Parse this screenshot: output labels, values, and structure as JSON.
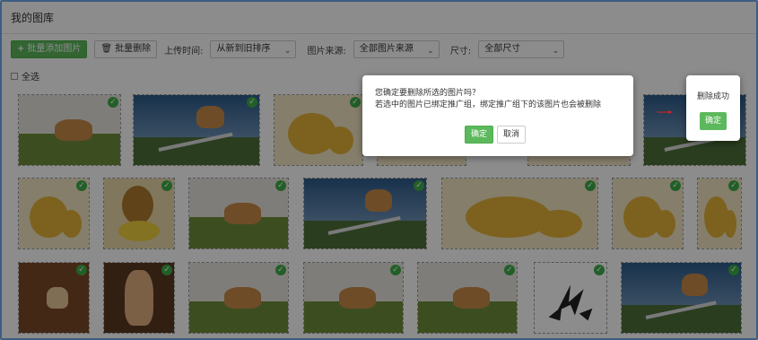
{
  "header": {
    "title": "我的图库"
  },
  "toolbar": {
    "batch_add_label": "批量添加图片",
    "batch_delete_label": "批量删除",
    "upload_time_label": "上传时间:",
    "upload_time_value": "从新到旧排序",
    "source_label": "图片来源:",
    "source_value": "全部图片来源",
    "size_label": "尺寸:",
    "size_value": "全部尺寸"
  },
  "select_all": {
    "label": "全选"
  },
  "dialog": {
    "line1": "您确定要删除所选的图片吗？",
    "line2": "若选中的图片已绑定推广组，绑定推广组下的该图片也会被删除",
    "confirm_label": "确定",
    "cancel_label": "取消"
  },
  "toast": {
    "message": "删除成功",
    "ok_label": "确定"
  },
  "colors": {
    "accent_green": "#5cb85c",
    "check_green": "#3fae49",
    "arrow_red": "#e02020",
    "frame_blue": "#3c5c82"
  },
  "tiles": [
    {
      "kind": "dog-grass",
      "checked": true
    },
    {
      "kind": "dog-jump",
      "checked": true
    },
    {
      "kind": "bear",
      "checked": true
    },
    {
      "kind": "bear",
      "checked": false
    },
    {
      "kind": "bear",
      "checked": false
    },
    {
      "kind": "dog-jump",
      "checked": false
    },
    {
      "kind": "bear",
      "checked": true
    },
    {
      "kind": "bear-family",
      "checked": true
    },
    {
      "kind": "dog-grass",
      "checked": true
    },
    {
      "kind": "dog-jump",
      "checked": true
    },
    {
      "kind": "bear",
      "checked": true
    },
    {
      "kind": "bear",
      "checked": true
    },
    {
      "kind": "bear",
      "checked": true
    },
    {
      "kind": "puppy-floor",
      "checked": true
    },
    {
      "kind": "puppy-sit",
      "checked": true
    },
    {
      "kind": "dog-grass",
      "checked": true
    },
    {
      "kind": "dog-grass",
      "checked": true
    },
    {
      "kind": "dog-grass",
      "checked": true
    },
    {
      "kind": "logo",
      "checked": true
    },
    {
      "kind": "dog-jump",
      "checked": true
    }
  ]
}
